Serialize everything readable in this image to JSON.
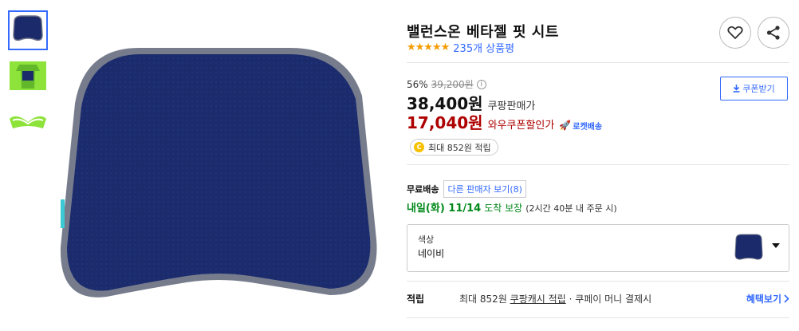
{
  "product": {
    "title": "밸런스온 베타젤 핏 시트",
    "stars": "★★★★★",
    "review_link": "235개 상품평"
  },
  "pricing": {
    "discount_rate": "56%",
    "original_price": "39,200원",
    "info_symbol": "i",
    "sale_price": "38,400원",
    "sale_label": "쿠팡판매가",
    "coupon_price": "17,040원",
    "coupon_label": "와우쿠폰할인가",
    "rocket_label": "로켓배송"
  },
  "coupon_button": {
    "label": "쿠폰받기"
  },
  "points_badge": {
    "coin": "C",
    "text": "최대 852원 적립"
  },
  "shipping": {
    "label": "무료배송",
    "seller_button": "다른 판매자 보기(8)",
    "delivery_day": "내일(화) 11/14",
    "delivery_suffix": "도착 보장",
    "delivery_note": "(2시간 40분 내 주문 시)"
  },
  "option": {
    "label": "색상",
    "value": "네이비"
  },
  "reward": {
    "label": "적립",
    "text_prefix": "최대 852원",
    "text_link": "쿠팡캐시 적립",
    "text_suffix": "· 쿠페이 머니 결제시",
    "benefit_link": "혜택보기"
  },
  "colors": {
    "accent": "#346aff",
    "coupon_red": "#ae0000",
    "delivery_green": "#00891a",
    "star": "#f59c00",
    "cushion_navy": "#1a2a6b"
  },
  "icons": {
    "heart": "heart-icon",
    "share": "share-icon",
    "download": "download-icon",
    "rocket": "rocket-icon",
    "chevron": "chevron-right-icon",
    "caret": "caret-down-icon"
  }
}
